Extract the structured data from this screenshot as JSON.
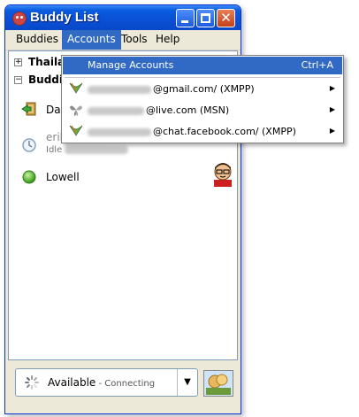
{
  "window": {
    "title": "Buddy List"
  },
  "menubar": [
    {
      "label": "Buddies",
      "active": false
    },
    {
      "label": "Accounts",
      "active": true
    },
    {
      "label": "Tools",
      "active": false
    },
    {
      "label": "Help",
      "active": false
    }
  ],
  "groups": [
    {
      "label": "Thailand",
      "expanded": false,
      "box": "+"
    },
    {
      "label": "Buddies",
      "expanded": true,
      "box": "−"
    }
  ],
  "buddies": [
    {
      "name": "Dan",
      "status_icon": "door-away-icon"
    },
    {
      "name": "erik",
      "idle": "Idle",
      "status_icon": "clock-idle-icon"
    },
    {
      "name": "Lowell",
      "status_icon": "green-available-icon"
    }
  ],
  "accounts_menu": {
    "manage": {
      "label": "Manage Accounts",
      "shortcut": "Ctrl+A"
    },
    "items": [
      {
        "suffix": "@gmail.com/ (XMPP)",
        "icon": "xmpp-icon"
      },
      {
        "suffix": "@live.com (MSN)",
        "icon": "msn-butterfly-icon"
      },
      {
        "suffix": "@chat.facebook.com/ (XMPP)",
        "icon": "xmpp-icon"
      }
    ]
  },
  "status": {
    "label": "Available",
    "connecting": " - Connecting"
  },
  "colors": {
    "title_bar": "#0a4fd6",
    "menu_highlight": "#316ac5"
  }
}
